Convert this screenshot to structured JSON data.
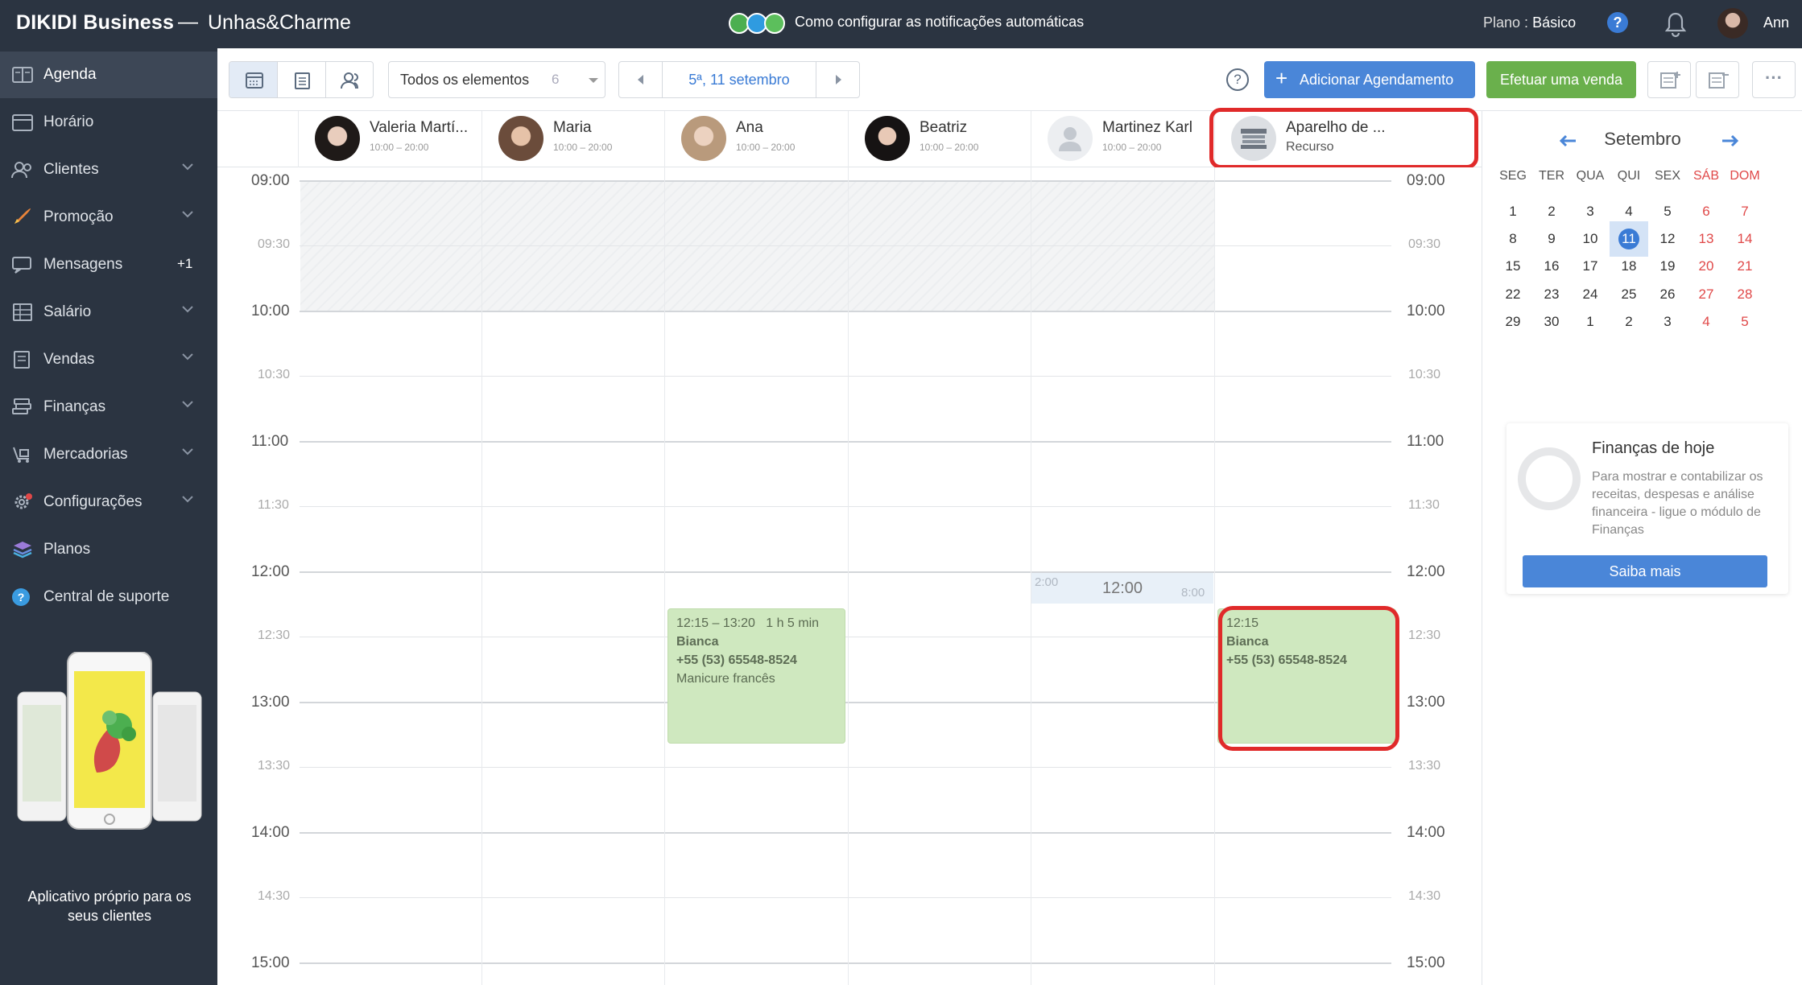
{
  "topbar": {
    "brand": "DIKIDI Business",
    "separator": "—",
    "salon": "Unhas&Charme",
    "promo_text": "Como configurar as notificações automáticas",
    "plan_label": "Plano :",
    "plan_value": "Básico",
    "help_label": "?",
    "user_name": "Ann"
  },
  "sidebar": {
    "items": [
      {
        "label": "Agenda",
        "icon": "agenda-icon"
      },
      {
        "label": "Horário",
        "icon": "schedule-icon"
      },
      {
        "label": "Clientes",
        "icon": "clients-icon"
      },
      {
        "label": "Promoção",
        "icon": "rocket-icon"
      },
      {
        "label": "Mensagens",
        "icon": "messages-icon",
        "badge": "+1"
      },
      {
        "label": "Salário",
        "icon": "salary-icon"
      },
      {
        "label": "Vendas",
        "icon": "sales-icon"
      },
      {
        "label": "Finanças",
        "icon": "finance-icon"
      },
      {
        "label": "Mercadorias",
        "icon": "goods-icon"
      },
      {
        "label": "Configurações",
        "icon": "settings-icon"
      },
      {
        "label": "Planos",
        "icon": "plans-icon"
      },
      {
        "label": "Central de suporte",
        "icon": "support-icon"
      }
    ],
    "app_promo": "Aplicativo próprio para os seus clientes"
  },
  "toolbar": {
    "filter_label": "Todos os elementos",
    "filter_count": "6",
    "date": "5ª, 11 setembro",
    "help_label": "?",
    "add_label": "Adicionar Agendamento",
    "add_plus": "+",
    "sale_label": "Efetuar uma venda",
    "more_label": "···"
  },
  "staff": [
    {
      "name": "Valeria Martí...",
      "hours": "10:00 – 20:00"
    },
    {
      "name": "Maria",
      "hours": "10:00 – 20:00"
    },
    {
      "name": "Ana",
      "hours": "10:00 – 20:00"
    },
    {
      "name": "Beatriz",
      "hours": "10:00 – 20:00"
    },
    {
      "name": "Martinez Karl",
      "hours": "10:00 – 20:00"
    },
    {
      "name": "Aparelho de ...",
      "sub": "Recurso"
    }
  ],
  "times": [
    "09:00",
    "09:30",
    "10:00",
    "10:30",
    "11:00",
    "11:30",
    "12:00",
    "12:30",
    "13:00",
    "13:30",
    "14:00",
    "14:30",
    "15:00"
  ],
  "appointments": {
    "ana": {
      "time": "12:15 – 13:20",
      "duration": "1 h 5 min",
      "client": "Bianca",
      "phone": "+55 (53) 65548-8524",
      "service": "Manicure francês"
    },
    "resource": {
      "time": "12:15",
      "client": "Bianca",
      "phone": "+55 (53) 65548-8524"
    }
  },
  "hover_slot": {
    "left": "2:00",
    "center": "12:00",
    "right": "8:00"
  },
  "calendar": {
    "month": "Setembro",
    "dow": [
      "SEG",
      "TER",
      "QUA",
      "QUI",
      "SEX",
      "SÁB",
      "DOM"
    ],
    "weeks": [
      [
        "1",
        "2",
        "3",
        "4",
        "5",
        "6",
        "7"
      ],
      [
        "8",
        "9",
        "10",
        "11",
        "12",
        "13",
        "14"
      ],
      [
        "15",
        "16",
        "17",
        "18",
        "19",
        "20",
        "21"
      ],
      [
        "22",
        "23",
        "24",
        "25",
        "26",
        "27",
        "28"
      ],
      [
        "29",
        "30",
        "1",
        "2",
        "3",
        "4",
        "5"
      ]
    ],
    "today": "11"
  },
  "finance_card": {
    "title": "Finanças de hoje",
    "text": "Para mostrar e contabilizar os receitas, despesas e análise financeira - ligue o módulo de Finanças",
    "button": "Saiba mais"
  },
  "colors": {
    "sidebar": "#2b3441",
    "accent": "#4a86d8",
    "sale": "#6ab04c",
    "appointment": "#cfe8bf",
    "highlight": "#e02a2a",
    "weekend": "#e04848"
  }
}
